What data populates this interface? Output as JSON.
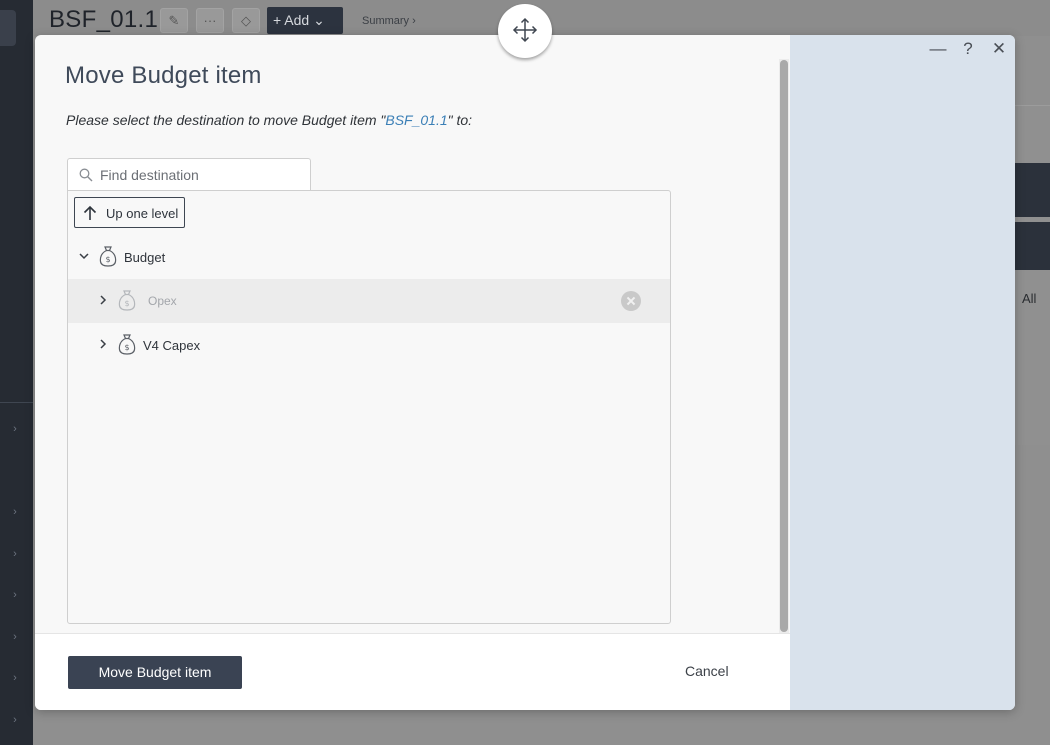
{
  "background": {
    "record_title": "BSF_01.1",
    "add_label": "Add",
    "summary_link": "Summary ›",
    "right_panel_text": "All"
  },
  "dialog": {
    "title": "Move Budget item",
    "instruction_prefix": "Please select the destination to move Budget item \"",
    "instruction_item": "BSF_01.1",
    "instruction_suffix": "\" to:",
    "search_placeholder": "Find destination",
    "up_one_level_label": "Up one level",
    "tree": [
      {
        "label": "Budget",
        "state": "expanded",
        "level": 0
      },
      {
        "label": "Opex",
        "state": "collapsed",
        "level": 1,
        "disabled": true
      },
      {
        "label": "V4 Capex",
        "state": "collapsed",
        "level": 1
      }
    ],
    "primary_action_label": "Move Budget item",
    "cancel_label": "Cancel",
    "window_controls": {
      "minimize": "—",
      "help": "?",
      "close": "✕"
    }
  },
  "colors": {
    "accent_link": "#3b7fb6",
    "primary_button": "#3a4353",
    "side_panel": "#d9e2ec"
  }
}
